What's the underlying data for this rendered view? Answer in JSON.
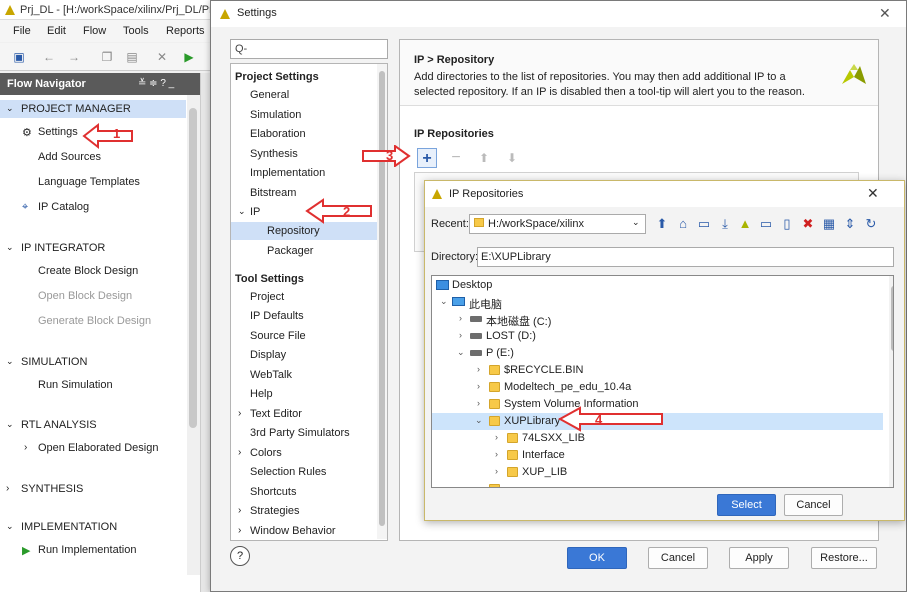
{
  "main_window": {
    "title": "Prj_DL - [H:/workSpace/xilinx/Prj_DL/Prj_D",
    "menu": [
      "File",
      "Edit",
      "Flow",
      "Tools",
      "Reports"
    ]
  },
  "flow_navigator": {
    "header": "Flow Navigator",
    "header_controls": "≚ ≑ ? _",
    "items": [
      {
        "label": "PROJECT MANAGER",
        "type": "section"
      },
      {
        "label": "Settings",
        "type": "item"
      },
      {
        "label": "Add Sources",
        "type": "item"
      },
      {
        "label": "Language Templates",
        "type": "item"
      },
      {
        "label": "IP Catalog",
        "type": "item"
      },
      {
        "label": "IP INTEGRATOR",
        "type": "section"
      },
      {
        "label": "Create Block Design",
        "type": "item"
      },
      {
        "label": "Open Block Design",
        "type": "disabled"
      },
      {
        "label": "Generate Block Design",
        "type": "disabled"
      },
      {
        "label": "SIMULATION",
        "type": "section"
      },
      {
        "label": "Run Simulation",
        "type": "item"
      },
      {
        "label": "RTL ANALYSIS",
        "type": "section"
      },
      {
        "label": "Open Elaborated Design",
        "type": "item"
      },
      {
        "label": "SYNTHESIS",
        "type": "section"
      },
      {
        "label": "IMPLEMENTATION",
        "type": "section"
      },
      {
        "label": "Run Implementation",
        "type": "item"
      }
    ]
  },
  "settings": {
    "title": "Settings",
    "search_placeholder": "Q-",
    "project_settings_header": "Project Settings",
    "project_items": [
      "General",
      "Simulation",
      "Elaboration",
      "Synthesis",
      "Implementation",
      "Bitstream",
      "IP",
      "Repository",
      "Packager"
    ],
    "tool_settings_header": "Tool Settings",
    "tool_items": [
      "Project",
      "IP Defaults",
      "Source File",
      "Display",
      "WebTalk",
      "Help",
      "Text Editor",
      "3rd Party Simulators",
      "Colors",
      "Selection Rules",
      "Shortcuts",
      "Strategies",
      "Window Behavior"
    ],
    "content_title": "IP > Repository",
    "content_desc": "Add directories to the list of repositories. You may then add additional IP to a selected repository. If an IP is disabled then a tool-tip will alert you to the reason.",
    "repositories_label": "IP Repositories",
    "buttons": {
      "ok": "OK",
      "cancel": "Cancel",
      "apply": "Apply",
      "restore": "Restore..."
    },
    "help": "?"
  },
  "ip_repo_dialog": {
    "title": "IP Repositories",
    "recent_label": "Recent:",
    "recent_value": "H:/workSpace/xilinx",
    "directory_label": "Directory:",
    "directory_value": "E:\\XUPLibrary",
    "tree": [
      {
        "label": "Desktop",
        "indent": 0,
        "chev": "",
        "icon": "desktop"
      },
      {
        "label": "此电脑",
        "indent": 1,
        "chev": "⌄",
        "icon": "pc"
      },
      {
        "label": "本地磁盘 (C:)",
        "indent": 2,
        "chev": "›",
        "icon": "drive"
      },
      {
        "label": "LOST (D:)",
        "indent": 2,
        "chev": "›",
        "icon": "drive"
      },
      {
        "label": "P (E:)",
        "indent": 2,
        "chev": "⌄",
        "icon": "drive"
      },
      {
        "label": "$RECYCLE.BIN",
        "indent": 3,
        "chev": "›",
        "icon": "folder"
      },
      {
        "label": "Modeltech_pe_edu_10.4a",
        "indent": 3,
        "chev": "›",
        "icon": "folder"
      },
      {
        "label": "System Volume Information",
        "indent": 3,
        "chev": "›",
        "icon": "folder"
      },
      {
        "label": "XUPLibrary",
        "indent": 3,
        "chev": "⌄",
        "icon": "folder"
      },
      {
        "label": "74LSXX_LIB",
        "indent": 4,
        "chev": "›",
        "icon": "folder"
      },
      {
        "label": "Interface",
        "indent": 4,
        "chev": "›",
        "icon": "folder"
      },
      {
        "label": "XUP_LIB",
        "indent": 4,
        "chev": "›",
        "icon": "folder"
      },
      {
        "label": "",
        "indent": 3,
        "chev": "",
        "icon": "folder"
      }
    ],
    "selected_index": 8,
    "buttons": {
      "select": "Select",
      "cancel": "Cancel"
    }
  },
  "annotations": [
    "1",
    "2",
    "3",
    "4"
  ],
  "colors": {
    "arrow": "#e03030",
    "accent": "#3a78d6",
    "selection": "#cfe0f7"
  }
}
